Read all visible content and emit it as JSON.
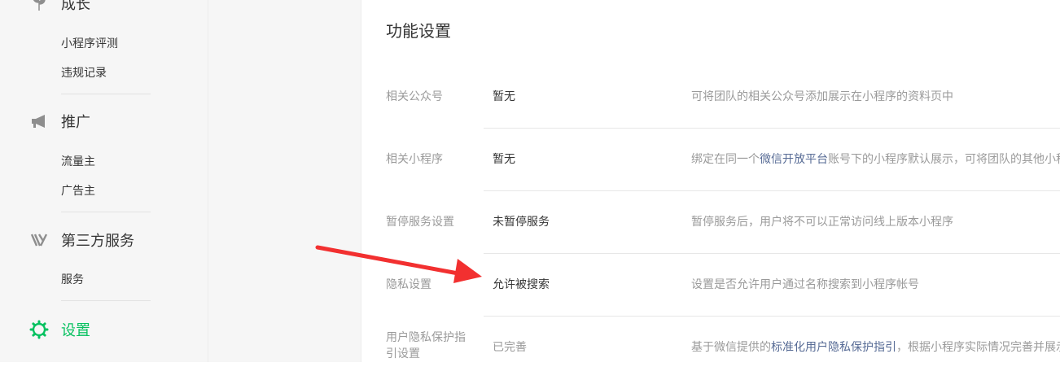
{
  "sidebar": {
    "groups": [
      {
        "label": "成长",
        "icon": "growth-icon",
        "items": [
          "小程序评测",
          "违规记录"
        ]
      },
      {
        "label": "推广",
        "icon": "megaphone-icon",
        "items": [
          "流量主",
          "广告主"
        ]
      },
      {
        "label": "第三方服务",
        "icon": "third-party-icon",
        "items": [
          "服务"
        ]
      },
      {
        "label": "设置",
        "icon": "gear-icon",
        "items": []
      }
    ]
  },
  "main": {
    "title": "功能设置",
    "rows": [
      {
        "label": "相关公众号",
        "value": "暂无",
        "desc": "可将团队的相关公众号添加展示在小程序的资料页中"
      },
      {
        "label": "相关小程序",
        "value": "暂无",
        "desc_pre": "绑定在同一个",
        "desc_link": "微信开放平台",
        "desc_post": "账号下的小程序默认展示，可将团队的其他小程"
      },
      {
        "label": "暂停服务设置",
        "value": "未暂停服务",
        "desc": "暂停服务后，用户将不可以正常访问线上版本小程序"
      },
      {
        "label": "隐私设置",
        "value": "允许被搜索",
        "desc": "设置是否允许用户通过名称搜索到小程序帐号"
      },
      {
        "label": "用户隐私保护指引设置",
        "value": "已完善",
        "desc_pre": "基于微信提供的",
        "desc_link": "标准化用户隐私保护指引",
        "desc_post": "，根据小程序实际情况完善并展示"
      }
    ]
  },
  "colors": {
    "accent": "#07c160",
    "link": "#576b95",
    "arrow": "#f23030"
  }
}
